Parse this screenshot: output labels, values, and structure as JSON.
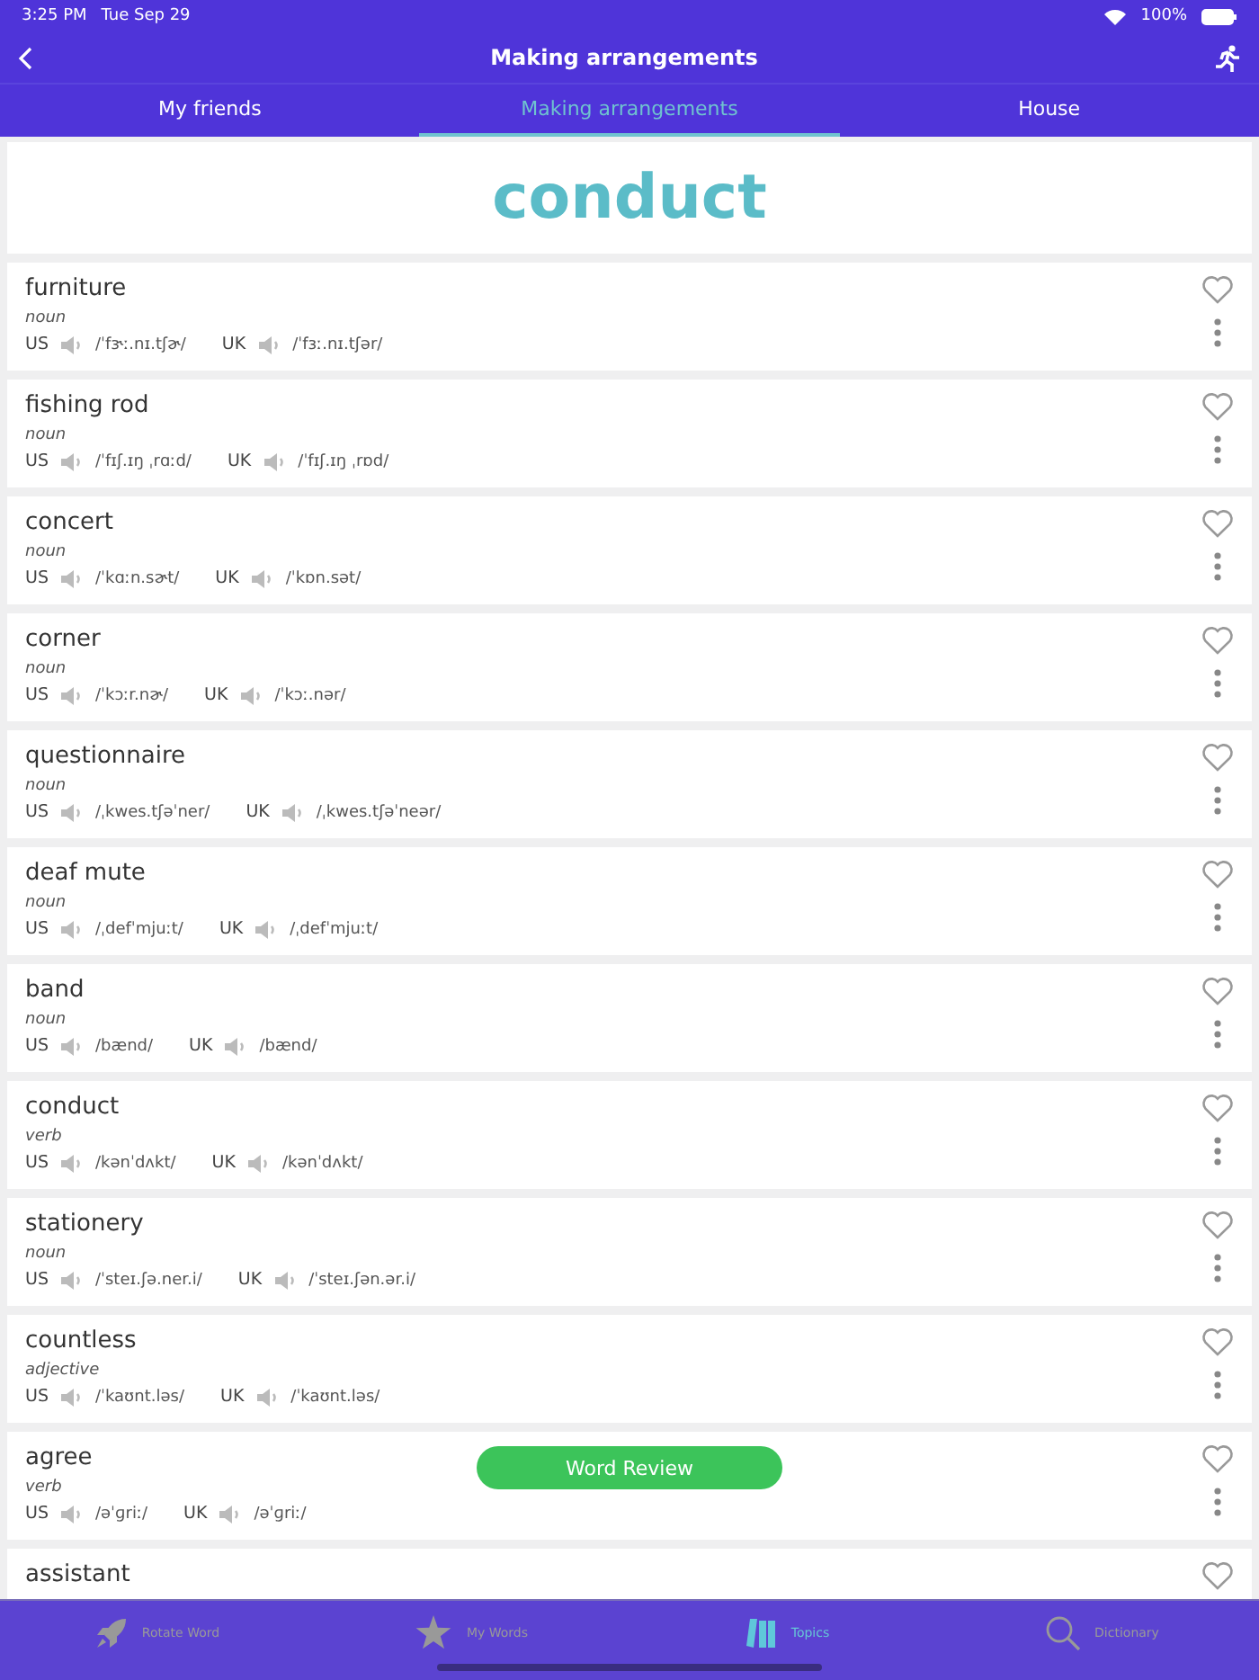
{
  "status_bar": {
    "time": "3:25 PM",
    "date": "Tue Sep 29",
    "battery": "100%"
  },
  "nav": {
    "title": "Making arrangements"
  },
  "tabs": [
    {
      "label": "My friends",
      "selected": false
    },
    {
      "label": "Making arrangements",
      "selected": true
    },
    {
      "label": "House",
      "selected": false
    }
  ],
  "headword": "conduct",
  "words": [
    {
      "word": "furniture",
      "pos": "noun",
      "us_label": "US",
      "us": "/ˈfɝː.nɪ.tʃɚ/",
      "uk_label": "UK",
      "uk": "/ˈfɜː.nɪ.tʃər/"
    },
    {
      "word": "fishing rod",
      "pos": "noun",
      "us_label": "US",
      "us": "/ˈfɪʃ.ɪŋ ˌrɑːd/",
      "uk_label": "UK",
      "uk": "/ˈfɪʃ.ɪŋ ˌrɒd/"
    },
    {
      "word": "concert",
      "pos": "noun",
      "us_label": "US",
      "us": "/ˈkɑːn.sɚt/",
      "uk_label": "UK",
      "uk": "/ˈkɒn.sət/"
    },
    {
      "word": "corner",
      "pos": "noun",
      "us_label": "US",
      "us": "/ˈkɔːr.nɚ/",
      "uk_label": "UK",
      "uk": "/ˈkɔː.nər/"
    },
    {
      "word": "questionnaire",
      "pos": "noun",
      "us_label": "US",
      "us": "/ˌkwes.tʃəˈner/",
      "uk_label": "UK",
      "uk": "/ˌkwes.tʃəˈneər/"
    },
    {
      "word": "deaf mute",
      "pos": "noun",
      "us_label": "US",
      "us": "/ˌdefˈmjuːt/",
      "uk_label": "UK",
      "uk": "/ˌdefˈmjuːt/"
    },
    {
      "word": "band",
      "pos": "noun",
      "us_label": "US",
      "us": "/bænd/",
      "uk_label": "UK",
      "uk": "/bænd/"
    },
    {
      "word": "conduct",
      "pos": "verb",
      "us_label": "US",
      "us": "/kənˈdʌkt/",
      "uk_label": "UK",
      "uk": "/kənˈdʌkt/"
    },
    {
      "word": "stationery",
      "pos": "noun",
      "us_label": "US",
      "us": "/ˈsteɪ.ʃə.ner.i/",
      "uk_label": "UK",
      "uk": "/ˈsteɪ.ʃən.ər.i/"
    },
    {
      "word": "countless",
      "pos": "adjective",
      "us_label": "US",
      "us": "/ˈkaʊnt.ləs/",
      "uk_label": "UK",
      "uk": "/ˈkaʊnt.ləs/"
    },
    {
      "word": "agree",
      "pos": "verb",
      "us_label": "US",
      "us": "/əˈɡriː/",
      "uk_label": "UK",
      "uk": "/əˈɡriː/"
    },
    {
      "word": "assistant"
    }
  ],
  "review_button": "Word Review",
  "bottom_tabs": [
    {
      "label": "Rotate Word",
      "selected": false
    },
    {
      "label": "My Words",
      "selected": false
    },
    {
      "label": "Topics",
      "selected": true
    },
    {
      "label": "Dictionary",
      "selected": false
    }
  ]
}
